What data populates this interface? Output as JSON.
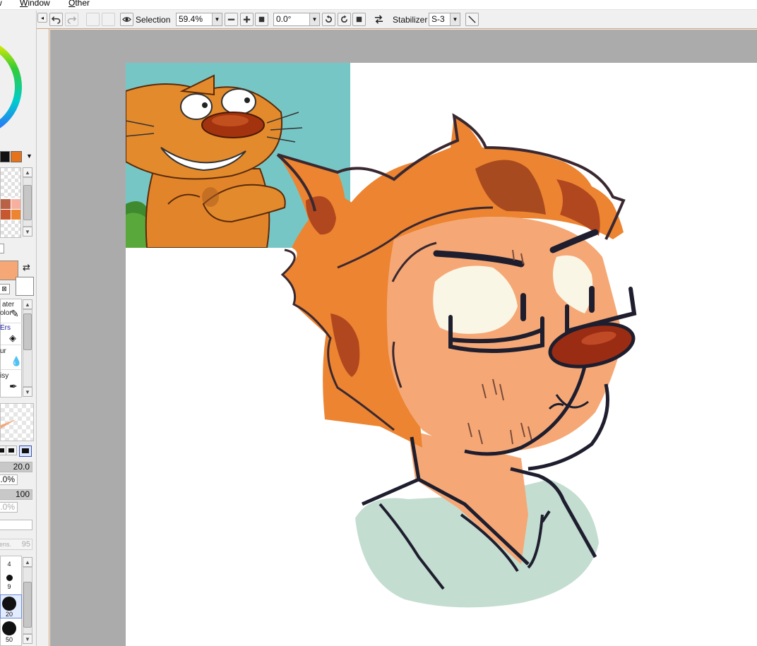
{
  "menu": {
    "items": [
      {
        "underlined": "W",
        "rest": "indow"
      },
      {
        "underlined": "O",
        "rest": "ther"
      }
    ],
    "cut_item": "w"
  },
  "toolbar": {
    "selection_label": "Selection",
    "zoom_value": "59.4%",
    "rotation_value": "0.0°",
    "stabilizer_label": "Stabilizer",
    "stabilizer_value": "S-3"
  },
  "brushes": {
    "items": [
      {
        "label1": "ater",
        "label2": "olor"
      },
      {
        "label1": "Ers",
        "label2": ""
      },
      {
        "label1": "ur",
        "label2": ""
      },
      {
        "label1": "isy",
        "label2": ""
      }
    ]
  },
  "brush_params": {
    "size": "20.0",
    "min_size": ".0%",
    "density": "100",
    "min_density": ".0%",
    "hidden_label": "ens.",
    "hidden_value": "95"
  },
  "size_presets": [
    "4",
    "9",
    "20",
    "50"
  ],
  "colors": {
    "accent": "#d4a37a",
    "primary": "#f5a876",
    "secondary": "#ffffff",
    "canvas_bg": "#ababab",
    "fur": "#ec8431",
    "skin": "#f5a876",
    "outline": "#1e1e2e",
    "shirt": "#c3ddd1",
    "nose": "#9a2c14",
    "ref_bg": "#77c6c6"
  },
  "icons": [
    "undo-icon",
    "redo-icon",
    "eye-icon",
    "zoom-out-icon",
    "zoom-in-icon",
    "rotate-left-icon",
    "rotate-right-icon",
    "flip-icon",
    "pen-icon",
    "swap-colors-icon"
  ]
}
